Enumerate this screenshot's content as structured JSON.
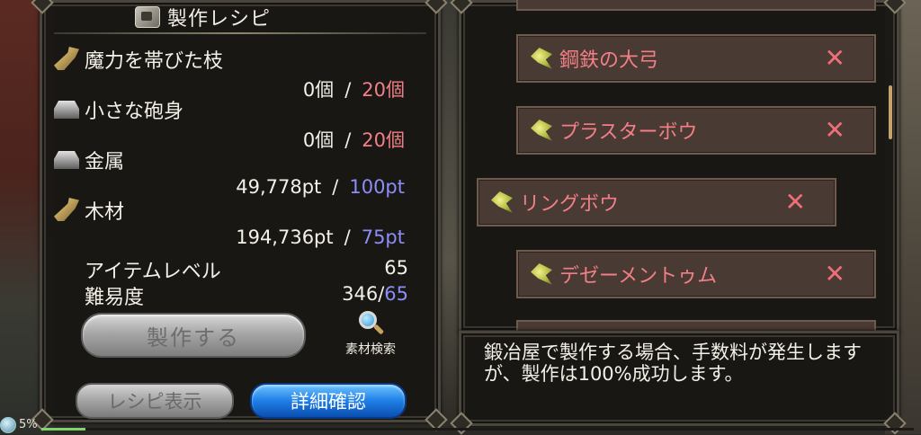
{
  "title": "製作レシピ",
  "materials": [
    {
      "name": "魔力を帯びた枝",
      "have": "0個",
      "sep": "/",
      "need": "20個",
      "icon": "branch-icon"
    },
    {
      "name": "小さな砲身",
      "have": "0個",
      "sep": "/",
      "need": "20個",
      "icon": "ingot-icon"
    },
    {
      "name": "金属",
      "have": "49,778pt",
      "sep": "/",
      "need": "100pt",
      "icon": "ingot-icon"
    },
    {
      "name": "木材",
      "have": "194,736pt",
      "sep": "/",
      "need": "75pt",
      "icon": "branch-icon"
    }
  ],
  "stats": {
    "item_level_label": "アイテムレベル",
    "item_level_value": "65",
    "difficulty_label": "難易度",
    "difficulty_have": "346",
    "difficulty_slash": "/",
    "difficulty_need": "65"
  },
  "buttons": {
    "craft": "製作する",
    "recipe_view": "レシピ表示",
    "detail_confirm": "詳細確認",
    "search_materials": "素材検索"
  },
  "recipes": [
    {
      "name": "鋼鉄の大弓",
      "mark": "✕",
      "selected": false
    },
    {
      "name": "プラスターボウ",
      "mark": "✕",
      "selected": false
    },
    {
      "name": "リングボウ",
      "mark": "✕",
      "selected": true
    },
    {
      "name": "デゼーメントゥム",
      "mark": "✕",
      "selected": false
    }
  ],
  "message": "鍛冶屋で製作する場合、手数料が発生しますが、製作は100%成功します。",
  "status": {
    "percent_label": "5%",
    "progress": 0.05
  },
  "colors": {
    "insufficient": "#f27f86",
    "sufficient": "#8d8df8",
    "selected_button": "#1f7fe6"
  }
}
